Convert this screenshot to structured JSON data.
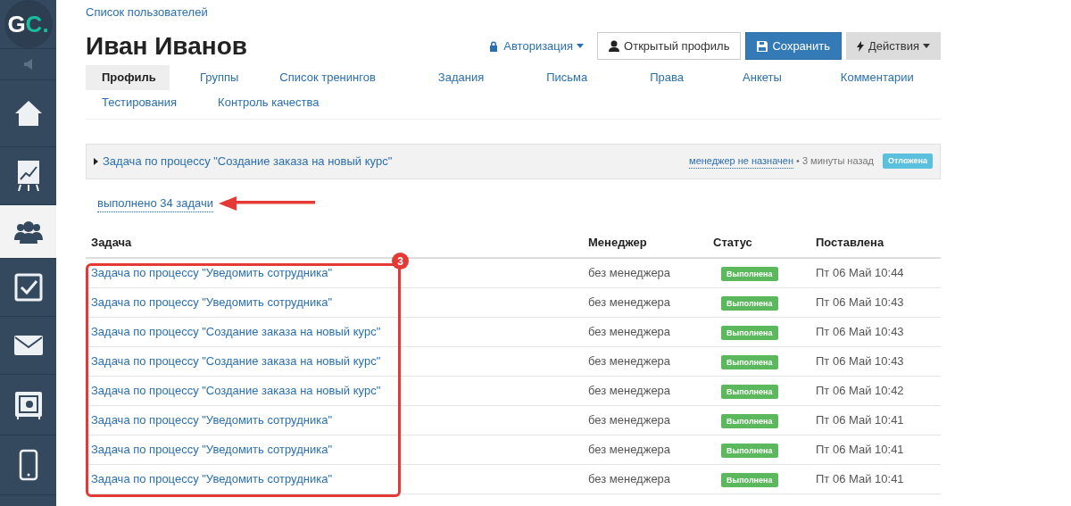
{
  "sidebar": {
    "logo": {
      "letter_1": "G",
      "letter_2": "C."
    },
    "items": [
      {
        "kind": "sound",
        "selected": false
      },
      {
        "kind": "home",
        "selected": false
      },
      {
        "kind": "chart",
        "selected": false
      },
      {
        "kind": "people",
        "selected": true
      },
      {
        "kind": "check",
        "selected": false
      },
      {
        "kind": "mail",
        "selected": false
      },
      {
        "kind": "safe",
        "selected": false
      },
      {
        "kind": "phone",
        "selected": false
      }
    ]
  },
  "breadcrumb": "Список пользователей",
  "title": "Иван Иванов",
  "actions": {
    "auth": "Авторизация",
    "open_profile": "Открытый профиль",
    "save": "Сохранить",
    "more": "Действия"
  },
  "tabs": [
    {
      "label": "Профиль",
      "selected": true
    },
    {
      "label": "Группы",
      "selected": false
    },
    {
      "label": "Список тренингов",
      "selected": false
    },
    {
      "label": "Задания",
      "selected": false
    },
    {
      "label": "Письма",
      "selected": false
    },
    {
      "label": "Права",
      "selected": false
    },
    {
      "label": "Анкеты",
      "selected": false
    },
    {
      "label": "Комментарии",
      "selected": false
    },
    {
      "label": "Тестирования",
      "selected": false
    },
    {
      "label": "Контроль качества",
      "selected": false
    }
  ],
  "current_task": {
    "title": "Задача по процессу \"Создание заказа на новый курс\"",
    "manager": "менеджер не назначен",
    "time": "• 3 минуты назад",
    "status": {
      "label": "Отложена",
      "kind": "postponed"
    }
  },
  "done_link": "выполнено 34 задачи",
  "table": {
    "columns": [
      "Задача",
      "Менеджер",
      "Статус",
      "Поставлена"
    ],
    "rows": [
      {
        "task": "Задача по процессу \"Уведомить сотрудника\"",
        "manager": "без менеджера",
        "status": {
          "label": "Выполнена",
          "kind": "done"
        },
        "date": "Пт 06 Май 10:44"
      },
      {
        "task": "Задача по процессу \"Уведомить сотрудника\"",
        "manager": "без менеджера",
        "status": {
          "label": "Выполнена",
          "kind": "done"
        },
        "date": "Пт 06 Май 10:43"
      },
      {
        "task": "Задача по процессу \"Создание заказа на новый курс\"",
        "manager": "без менеджера",
        "status": {
          "label": "Выполнена",
          "kind": "done"
        },
        "date": "Пт 06 Май 10:43"
      },
      {
        "task": "Задача по процессу \"Создание заказа на новый курс\"",
        "manager": "без менеджера",
        "status": {
          "label": "Выполнена",
          "kind": "done"
        },
        "date": "Пт 06 Май 10:43"
      },
      {
        "task": "Задача по процессу \"Создание заказа на новый курс\"",
        "manager": "без менеджера",
        "status": {
          "label": "Выполнена",
          "kind": "done"
        },
        "date": "Пт 06 Май 10:42"
      },
      {
        "task": "Задача по процессу \"Уведомить сотрудника\"",
        "manager": "без менеджера",
        "status": {
          "label": "Выполнена",
          "kind": "done"
        },
        "date": "Пт 06 Май 10:41"
      },
      {
        "task": "Задача по процессу \"Уведомить сотрудника\"",
        "manager": "без менеджера",
        "status": {
          "label": "Выполнена",
          "kind": "done"
        },
        "date": "Пт 06 Май 10:41"
      },
      {
        "task": "Задача по процессу \"Уведомить сотрудника\"",
        "manager": "без менеджера",
        "status": {
          "label": "Выполнена",
          "kind": "done"
        },
        "date": "Пт 06 Май 10:41"
      }
    ]
  },
  "annotation": {
    "badge": "3"
  }
}
